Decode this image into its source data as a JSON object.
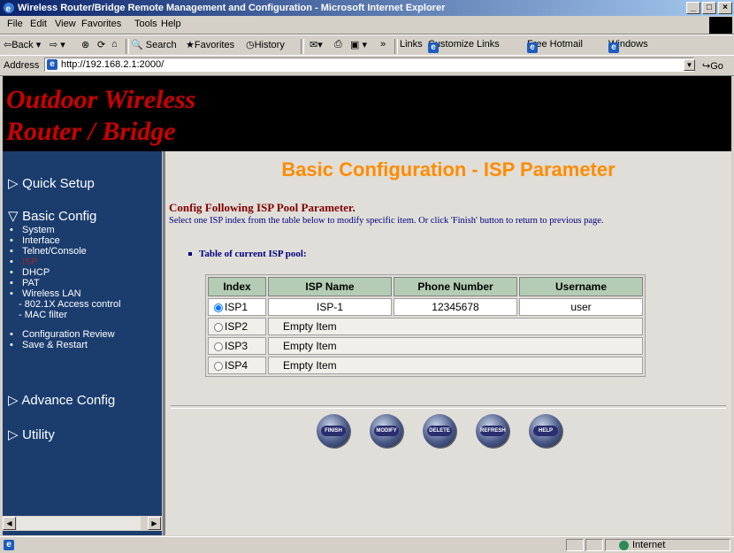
{
  "window": {
    "title": "Wireless Router/Bridge Remote Management and Configuration - Microsoft Internet Explorer",
    "minimize": "_",
    "maximize": "□",
    "close": "×"
  },
  "menu": [
    "File",
    "Edit",
    "View",
    "Favorites",
    "Tools",
    "Help"
  ],
  "toolbar": {
    "back": "⇦Back ▾",
    "forward": "⇨ ▾",
    "search": "Search",
    "favorites": "Favorites",
    "history": "History",
    "chevron": "»",
    "links": "Links",
    "customize": "Customize Links",
    "hotmail": "Free Hotmail",
    "windows": "Windows"
  },
  "address": {
    "label": "Address",
    "url": "http://192.168.2.1:2000/",
    "go": "Go"
  },
  "banner": {
    "line1": "Outdoor Wireless",
    "line2": "Router / Bridge"
  },
  "sidebar": {
    "quick_setup": "Quick Setup",
    "basic_config": "Basic Config",
    "items": [
      "System",
      "Interface",
      "Telnet/Console",
      "ISP",
      "DHCP",
      "PAT",
      "Wireless LAN"
    ],
    "sub_items": [
      "- 802.1X Access control",
      "- MAC filter"
    ],
    "items2": [
      "Configuration Review",
      "Save & Restart"
    ],
    "advance_config": "Advance Config",
    "utility": "Utility"
  },
  "main": {
    "title": "Basic Configuration - ISP Parameter",
    "heading": "Config Following ISP Pool Parameter.",
    "description": "Select one ISP index from the table below to modify specific item. Or click 'Finish' button to return to previous page.",
    "table_label": "Table of current ISP pool:"
  },
  "table": {
    "headers": [
      "Index",
      "ISP Name",
      "Phone Number",
      "Username"
    ],
    "rows": [
      {
        "index": "ISP1",
        "name": "ISP-1",
        "phone": "12345678",
        "username": "user",
        "selected": true
      },
      {
        "index": "ISP2",
        "name": "Empty Item",
        "selected": false
      },
      {
        "index": "ISP3",
        "name": "Empty Item",
        "selected": false
      },
      {
        "index": "ISP4",
        "name": "Empty Item",
        "selected": false
      }
    ]
  },
  "buttons": [
    "FINISH",
    "MODIFY",
    "DELETE",
    "REFRESH",
    "HELP"
  ],
  "status": {
    "zone": "Internet"
  },
  "colors": {
    "title_orange": "#ff8c00",
    "banner_red": "#cc0000",
    "sidebar_blue": "#1b3d6e",
    "table_header": "#b4ccb4"
  }
}
